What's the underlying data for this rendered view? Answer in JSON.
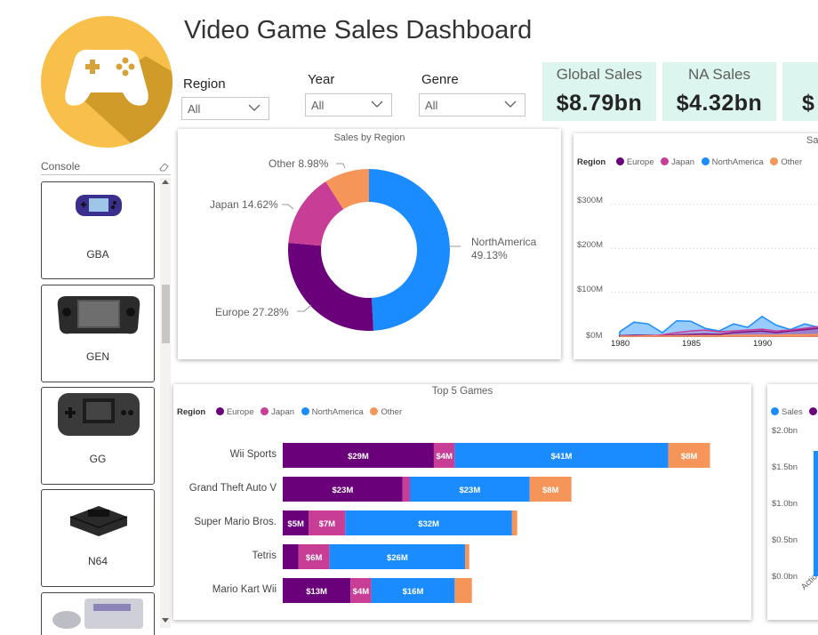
{
  "page": {
    "title": "Video Game Sales Dashboard"
  },
  "colors": {
    "europe": "#6b007b",
    "japan": "#c83d95",
    "northamerica": "#1a8cff",
    "other": "#f6955a",
    "kpi_bg": "#dcf6ef",
    "logo_yellow": "#f8c04b",
    "logo_shadow": "#d19b2a"
  },
  "logo": {
    "icon": "gamepad-icon"
  },
  "filters": [
    {
      "label": "Region",
      "value": "All"
    },
    {
      "label": "Year",
      "value": "All"
    },
    {
      "label": "Genre",
      "value": "All"
    }
  ],
  "kpis": [
    {
      "label": "Global Sales",
      "value": "$8.79bn"
    },
    {
      "label": "NA Sales",
      "value": "$4.32bn"
    },
    {
      "label": "",
      "value": "$"
    }
  ],
  "console_slicer": {
    "header": "Console",
    "items": [
      {
        "name": "GBA",
        "icon": "gameboy-advance-icon"
      },
      {
        "name": "GEN",
        "icon": "handheld-console-icon"
      },
      {
        "name": "GG",
        "icon": "game-gear-icon"
      },
      {
        "name": "N64",
        "icon": "n64-console-icon"
      },
      {
        "name": "",
        "icon": "snes-console-icon"
      }
    ]
  },
  "charts": {
    "donut": {
      "title": "Sales by Region",
      "labels": [
        "Other 8.98%",
        "Japan 14.62%",
        "Europe 27.28%",
        "NorthAmerica",
        "49.13%"
      ]
    },
    "area": {
      "title": "Sa",
      "legend_title": "Region",
      "legend": [
        "Europe",
        "Japan",
        "NorthAmerica",
        "Other"
      ],
      "y_ticks": [
        "$300M",
        "$200M",
        "$100M",
        "$0M"
      ],
      "x_ticks": [
        "1980",
        "1985",
        "1990"
      ]
    },
    "top5": {
      "title": "Top 5 Games",
      "legend_title": "Region",
      "legend": [
        "Europe",
        "Japan",
        "NorthAmerica",
        "Other"
      ]
    },
    "genre": {
      "legend": [
        "Sales",
        "%"
      ],
      "y_ticks": [
        "$2.0bn",
        "$1.5bn",
        "$1.0bn",
        "$0.5bn",
        "$0.0bn"
      ],
      "x_ticks": [
        "Actio"
      ]
    }
  },
  "chart_data": [
    {
      "type": "pie",
      "title": "Sales by Region",
      "categories": [
        "NorthAmerica",
        "Europe",
        "Japan",
        "Other"
      ],
      "values": [
        49.13,
        27.28,
        14.62,
        8.98
      ],
      "unit": "%"
    },
    {
      "type": "bar",
      "title": "Top 5 Games",
      "categories": [
        "Wii Sports",
        "Grand Theft Auto V",
        "Super Mario Bros.",
        "Tetris",
        "Mario Kart Wii"
      ],
      "series": [
        {
          "name": "Europe",
          "values": [
            29,
            23,
            5,
            3,
            13
          ],
          "labels": [
            "$29M",
            "$23M",
            "$5M",
            "",
            "$13M"
          ]
        },
        {
          "name": "Japan",
          "values": [
            4,
            1.4,
            7,
            6,
            4
          ],
          "labels": [
            "$4M",
            "",
            "$7M",
            "$6M",
            "$4M"
          ]
        },
        {
          "name": "NorthAmerica",
          "values": [
            41,
            23,
            32,
            26,
            16
          ],
          "labels": [
            "$41M",
            "$23M",
            "$32M",
            "$26M",
            "$16M"
          ]
        },
        {
          "name": "Other",
          "values": [
            8,
            8,
            1,
            0.8,
            3.3
          ],
          "labels": [
            "$8M",
            "$8M",
            "",
            "",
            ""
          ]
        }
      ],
      "xlim": [
        0,
        85
      ]
    },
    {
      "type": "area",
      "title": "Sa",
      "x": [
        1980,
        1981,
        1982,
        1983,
        1984,
        1985,
        1986,
        1987,
        1988,
        1989,
        1990,
        1991,
        1992,
        1993,
        1994
      ],
      "series": [
        {
          "name": "NorthAmerica",
          "values": [
            10,
            32,
            28,
            8,
            35,
            34,
            18,
            12,
            28,
            20,
            45,
            25,
            15,
            28,
            20
          ]
        },
        {
          "name": "Europe",
          "values": [
            1,
            2,
            2,
            1,
            3,
            4,
            5,
            4,
            8,
            10,
            12,
            8,
            12,
            15,
            18
          ]
        },
        {
          "name": "Japan",
          "values": [
            0,
            0,
            0,
            3,
            8,
            12,
            14,
            10,
            12,
            14,
            16,
            12,
            14,
            18,
            22
          ]
        },
        {
          "name": "Other",
          "values": [
            0,
            0,
            1,
            0,
            1,
            1,
            1,
            1,
            2,
            2,
            2,
            2,
            3,
            3,
            4
          ]
        }
      ],
      "ylim": [
        0,
        330
      ]
    },
    {
      "type": "bar",
      "title": "",
      "categories": [
        "Actio"
      ],
      "series": [
        {
          "name": "Sales",
          "values": [
            1.72
          ]
        }
      ],
      "ylim": [
        0,
        2.0
      ]
    }
  ]
}
